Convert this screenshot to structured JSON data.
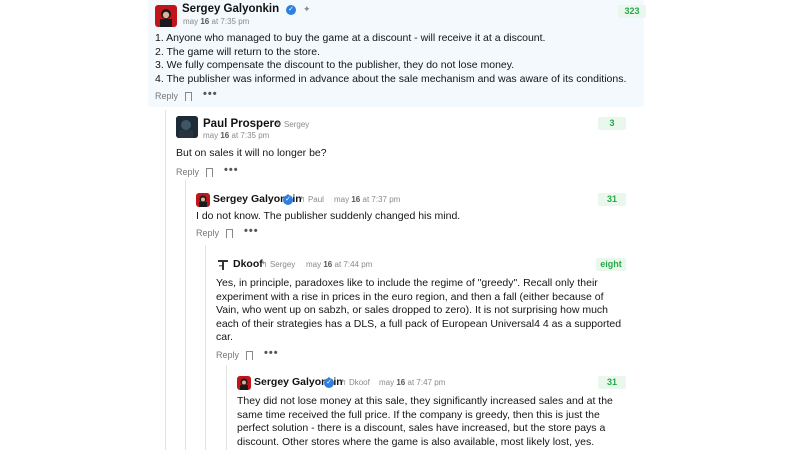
{
  "comments": [
    {
      "author": "Sergey Galyonkin",
      "time_prefix": "may",
      "time_day": "16",
      "time_suffix": "at 7:35 pm",
      "score": "323",
      "lines": [
        "1. Anyone who managed to buy the game at a discount - will receive it at a discount.",
        "2. The game will return to the store.",
        "3. We fully compensate the discount to the publisher, they do not lose money.",
        "4. The publisher was informed in advance about the sale mechanism and was aware of its conditions."
      ],
      "reply_label": "Reply",
      "more": "•••"
    },
    {
      "author": "Paul Prospero",
      "reply_to": "Sergey",
      "time_prefix": "may",
      "time_day": "16",
      "time_suffix": "at 7:35 pm",
      "score": "3",
      "lines": [
        "But on sales it will no longer be?"
      ],
      "reply_label": "Reply",
      "more": "•••"
    },
    {
      "author": "Sergey Galyonkin",
      "reply_to": "Paul",
      "time_prefix": "may",
      "time_day": "16",
      "time_suffix": "at 7:37 pm",
      "score": "31",
      "lines": [
        "I do not know. The publisher suddenly changed his mind."
      ],
      "reply_label": "Reply",
      "more": "•••"
    },
    {
      "author": "Dkoof",
      "reply_to": "Sergey",
      "time_prefix": "may",
      "time_day": "16",
      "time_suffix": "at 7:44 pm",
      "score": "eight",
      "lines": [
        "Yes, in principle, paradoxes like to include the regime of \"greedy\". Recall only their",
        "experiment with a rise in prices in the euro region, and then a fall (either because of",
        "Vain, who went up on sabzh, or sales dropped to zero). It is not surprising how much",
        "each of their strategies has a DLS, a full pack of European Universal4 4 as a supported",
        "car."
      ],
      "reply_label": "Reply",
      "more": "•••"
    },
    {
      "author": "Sergey Galyonkin",
      "reply_to": "Dkoof",
      "time_prefix": "may",
      "time_day": "16",
      "time_suffix": "at 7:47 pm",
      "score": "31",
      "lines": [
        "They did not lose money at this sale, they significantly increased sales and at the",
        "same time received the full price. If the company is greedy, then this is just the",
        "perfect solution - there is a discount, sales have increased, but the store pays a",
        "discount. Other stores where the game is also available, most likely lost, yes."
      ]
    }
  ],
  "reply_arrow": "↰",
  "verified_mark": "✓",
  "pin_mark": "✦",
  "colors": {
    "score_bg": "#eaf7ec",
    "score_fg": "#2aa84a",
    "highlight_bg": "#f3f9fd",
    "verified": "#2f7fe0"
  }
}
